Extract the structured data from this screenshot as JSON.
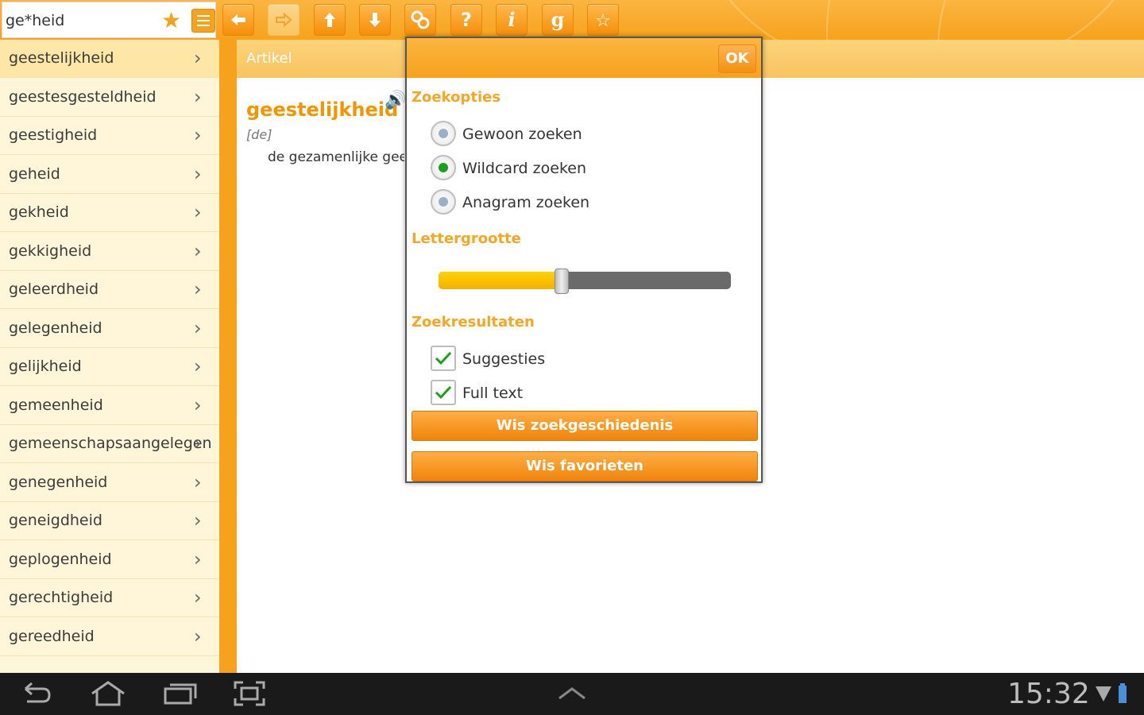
{
  "search": {
    "value": "ge*heid"
  },
  "toolbar": {
    "icons": [
      "back-arrow-icon",
      "forward-arrow-icon",
      "up-arrow-icon",
      "down-arrow-icon",
      "search-link-icon",
      "help-icon",
      "info-icon",
      "google-icon",
      "favorite-star-icon"
    ],
    "help_glyph": "?",
    "info_glyph": "i",
    "google_glyph": "g"
  },
  "word_list": [
    "geestelijkheid",
    "geestesgesteldheid",
    "geestigheid",
    "geheid",
    "gekheid",
    "gekkigheid",
    "geleerdheid",
    "gelegenheid",
    "gelijkheid",
    "gemeenheid",
    "gemeenschapsaangelegen",
    "genegenheid",
    "geneigdheid",
    "geplogenheid",
    "gerechtigheid",
    "gereedheid"
  ],
  "article": {
    "header": "Artikel",
    "headword": "geestelijkheid",
    "type": "[de]",
    "definition": "de gezamenlijke gee"
  },
  "dialog": {
    "ok_label": "OK",
    "search_options_title": "Zoekopties",
    "search_options": [
      {
        "label": "Gewoon zoeken",
        "checked": false
      },
      {
        "label": "Wildcard zoeken",
        "checked": true
      },
      {
        "label": "Anagram zoeken",
        "checked": false
      }
    ],
    "font_size_title": "Lettergrootte",
    "font_size_level": 0.42,
    "results_title": "Zoekresultaten",
    "results_options": [
      {
        "label": "Suggesties",
        "checked": true
      },
      {
        "label": "Full text",
        "checked": true
      }
    ],
    "clear_history_label": "Wis zoekgeschiedenis",
    "clear_favorites_label": "Wis favorieten"
  },
  "status_bar": {
    "time": "15:32"
  },
  "colors": {
    "accent": "#f7a21c",
    "selected_radio": "#16a316"
  }
}
